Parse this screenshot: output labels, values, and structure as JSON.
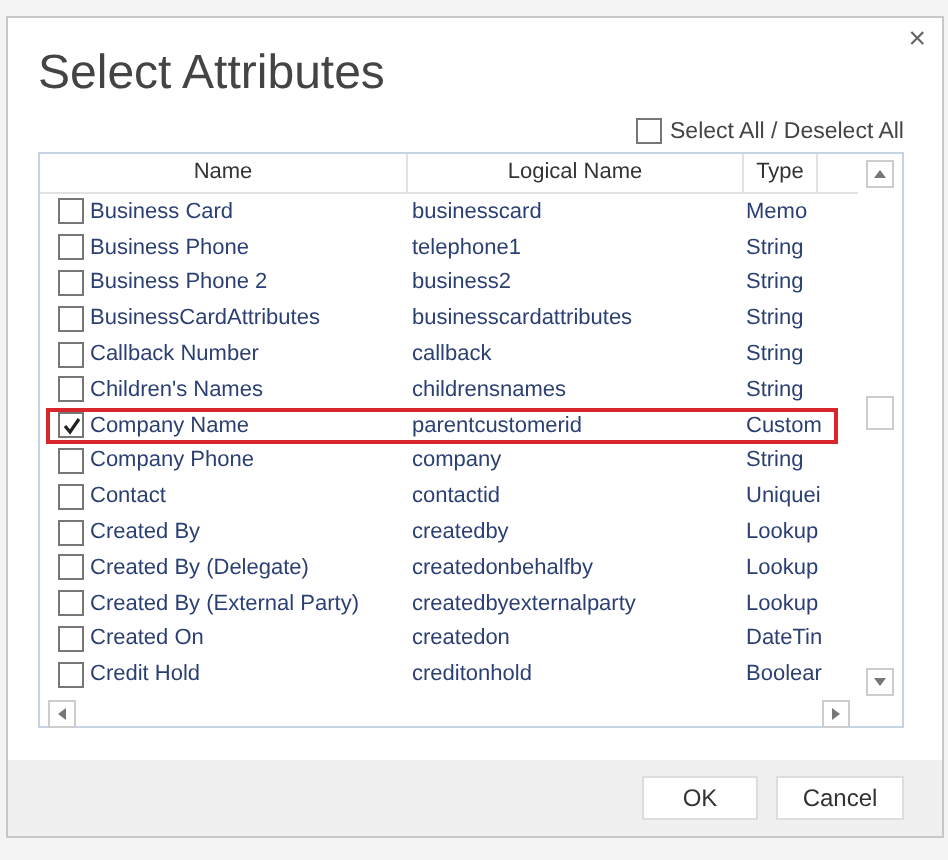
{
  "dialog": {
    "title": "Select Attributes",
    "close": "×"
  },
  "select_all": {
    "label": "Select All / Deselect All",
    "checked": false
  },
  "table": {
    "columns": [
      "Name",
      "Logical Name",
      "Type"
    ],
    "rows": [
      {
        "name": "Business Card",
        "logical_name": "businesscard",
        "type": "Memo",
        "checked": false,
        "highlighted": false
      },
      {
        "name": "Business Phone",
        "logical_name": "telephone1",
        "type": "String",
        "checked": false,
        "highlighted": false
      },
      {
        "name": "Business Phone 2",
        "logical_name": "business2",
        "type": "String",
        "checked": false,
        "highlighted": false
      },
      {
        "name": "BusinessCardAttributes",
        "logical_name": "businesscardattributes",
        "type": "String",
        "checked": false,
        "highlighted": false
      },
      {
        "name": "Callback Number",
        "logical_name": "callback",
        "type": "String",
        "checked": false,
        "highlighted": false
      },
      {
        "name": "Children's Names",
        "logical_name": "childrensnames",
        "type": "String",
        "checked": false,
        "highlighted": false
      },
      {
        "name": "Company Name",
        "logical_name": "parentcustomerid",
        "type": "Custom",
        "checked": true,
        "highlighted": true
      },
      {
        "name": "Company Phone",
        "logical_name": "company",
        "type": "String",
        "checked": false,
        "highlighted": false
      },
      {
        "name": "Contact",
        "logical_name": "contactid",
        "type": "Uniquei",
        "checked": false,
        "highlighted": false
      },
      {
        "name": "Created By",
        "logical_name": "createdby",
        "type": "Lookup",
        "checked": false,
        "highlighted": false
      },
      {
        "name": "Created By (Delegate)",
        "logical_name": "createdonbehalfby",
        "type": "Lookup",
        "checked": false,
        "highlighted": false
      },
      {
        "name": "Created By (External Party)",
        "logical_name": "createdbyexternalparty",
        "type": "Lookup",
        "checked": false,
        "highlighted": false
      },
      {
        "name": "Created On",
        "logical_name": "createdon",
        "type": "DateTin",
        "checked": false,
        "highlighted": false
      },
      {
        "name": "Credit Hold",
        "logical_name": "creditonhold",
        "type": "Boolear",
        "checked": false,
        "highlighted": false
      }
    ]
  },
  "buttons": [
    "OK",
    "Cancel"
  ]
}
